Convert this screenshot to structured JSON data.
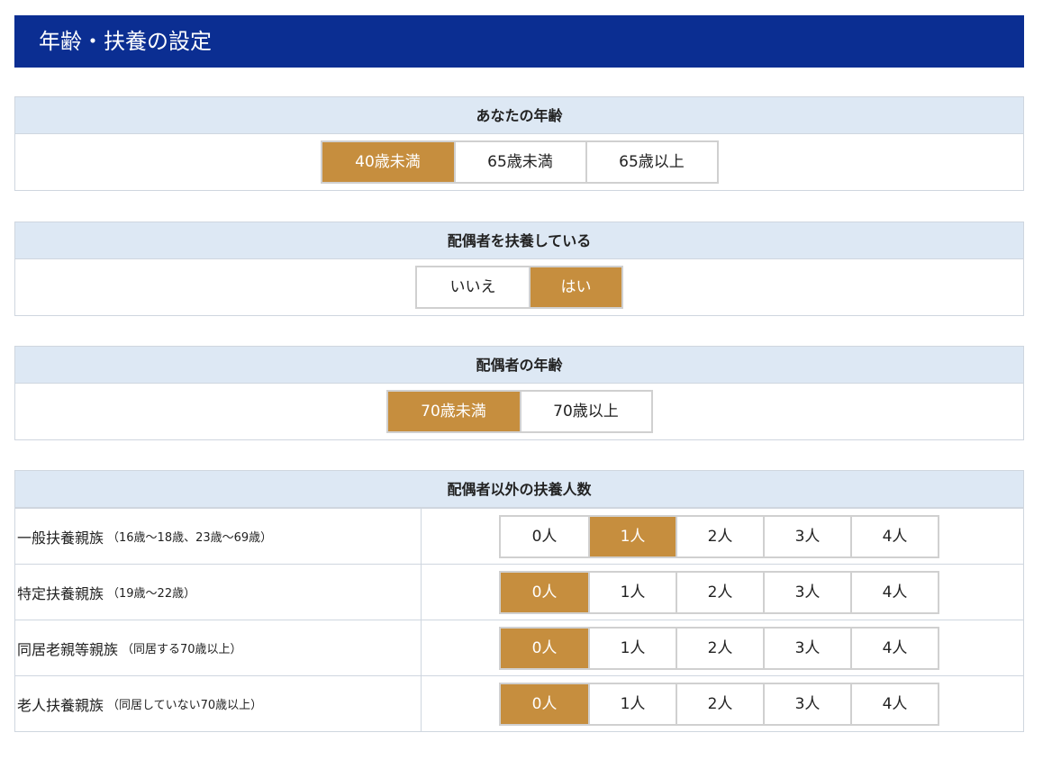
{
  "header": {
    "title": "年齢・扶養の設定"
  },
  "age": {
    "title": "あなたの年齢",
    "options": [
      "40歳未満",
      "65歳未満",
      "65歳以上"
    ],
    "selected": "40歳未満"
  },
  "spouse": {
    "title": "配偶者を扶養している",
    "options": [
      "いいえ",
      "はい"
    ],
    "selected": "はい"
  },
  "spouse_age": {
    "title": "配偶者の年齢",
    "options": [
      "70歳未満",
      "70歳以上"
    ],
    "selected": "70歳未満"
  },
  "dependents": {
    "title": "配偶者以外の扶養人数",
    "options": [
      "0人",
      "1人",
      "2人",
      "3人",
      "4人"
    ],
    "rows": [
      {
        "label": "一般扶養親族",
        "note": "（16歳〜18歳、23歳〜69歳）",
        "selected": "1人"
      },
      {
        "label": "特定扶養親族",
        "note": "（19歳〜22歳）",
        "selected": "0人"
      },
      {
        "label": "同居老親等親族",
        "note": "（同居する70歳以上）",
        "selected": "0人"
      },
      {
        "label": "老人扶養親族",
        "note": "（同居していない70歳以上）",
        "selected": "0人"
      }
    ]
  }
}
